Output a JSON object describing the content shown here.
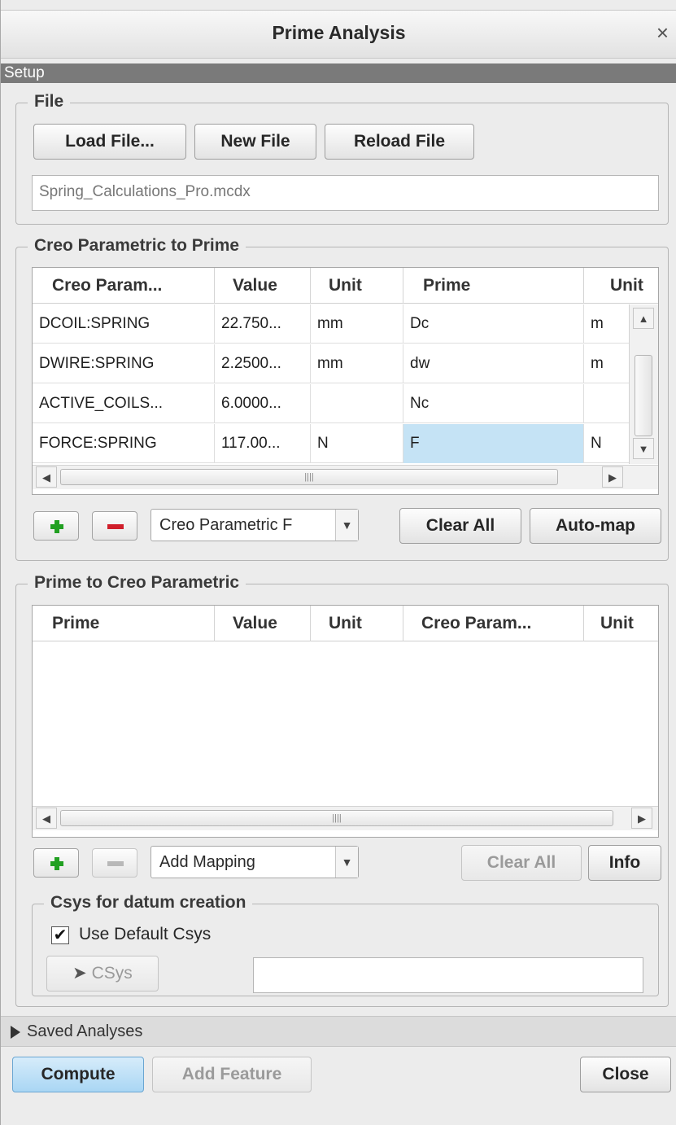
{
  "window": {
    "title": "Prime Analysis",
    "close_glyph": "×"
  },
  "setup_label": "Setup",
  "file_group": {
    "legend": "File",
    "load_button": "Load File...",
    "new_button": "New File",
    "reload_button": "Reload File",
    "file_name": "Spring_Calculations_Pro.mcdx"
  },
  "creo_to_prime": {
    "legend": "Creo Parametric to Prime",
    "columns": [
      "Creo Param...",
      "Value",
      "Unit",
      "Prime",
      "Unit"
    ],
    "rows": [
      [
        "DCOIL:SPRING",
        "22.750...",
        "mm",
        "Dc",
        "m"
      ],
      [
        "DWIRE:SPRING",
        "2.2500...",
        "mm",
        "dw",
        "m"
      ],
      [
        "ACTIVE_COILS...",
        "6.0000...",
        "",
        "Nc",
        ""
      ],
      [
        "FORCE:SPRING",
        "117.00...",
        "N",
        "F",
        "N"
      ]
    ],
    "selected_cell": "F",
    "combo_value": "Creo Parametric F",
    "clear_all": "Clear All",
    "auto_map": "Auto-map"
  },
  "prime_to_creo": {
    "legend": "Prime to Creo Parametric",
    "columns": [
      "Prime",
      "Value",
      "Unit",
      "Creo Param...",
      "Unit"
    ],
    "combo_value": "Add Mapping",
    "clear_all": "Clear All",
    "info": "Info"
  },
  "csys_group": {
    "legend": "Csys for datum creation",
    "use_default_label": "Use Default Csys",
    "use_default_checked": true,
    "csys_button": "CSys",
    "csys_value": ""
  },
  "saved_analyses": "Saved Analyses",
  "footer": {
    "compute": "Compute",
    "add_feature": "Add Feature",
    "close": "Close"
  },
  "icons": [
    "close-icon",
    "add-icon",
    "remove-icon",
    "dropdown-arrow-icon",
    "scroll-up-icon",
    "scroll-down-icon",
    "scroll-left-icon",
    "scroll-right-icon",
    "cursor-arrow-icon",
    "expand-triangle-icon",
    "checkmark-icon"
  ]
}
